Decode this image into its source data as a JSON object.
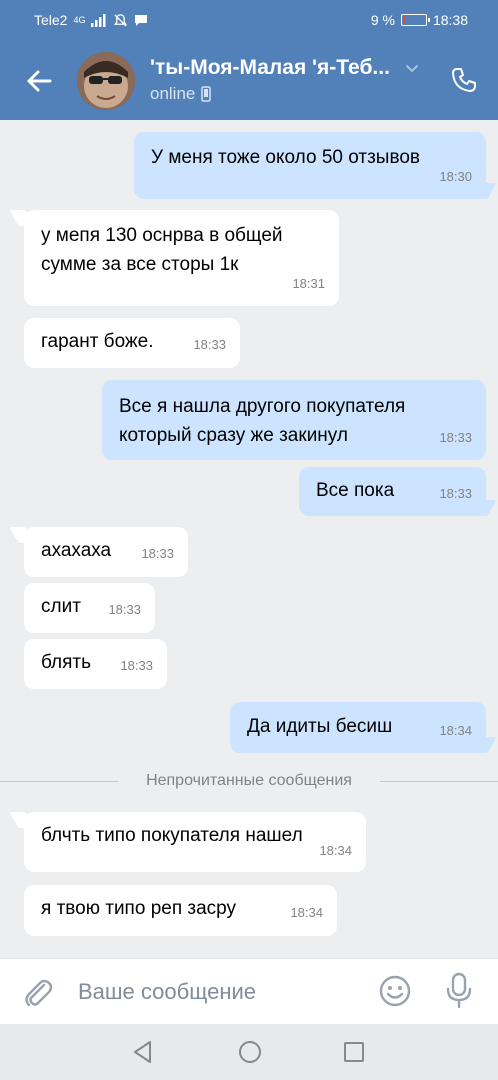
{
  "status_bar": {
    "carrier": "Tele2",
    "network": "4G",
    "battery_text": "9 %",
    "battery_level": 0.09,
    "battery_color": "#e64646",
    "time": "18:38"
  },
  "header": {
    "title": "'ты-Моя-Малая 'я-Теб...",
    "status": "online",
    "back_icon": "arrow-left-icon",
    "call_icon": "phone-icon",
    "bg_color": "#5181b8"
  },
  "messages": [
    {
      "direction": "out",
      "text": "У меня тоже около 50 отзывов",
      "time": "18:30"
    },
    {
      "direction": "in",
      "text": "у мепя 130 оснрва в общей сумме за все сторы 1к",
      "time": "18:31"
    },
    {
      "direction": "in",
      "text": "гарант боже.",
      "time": "18:33"
    },
    {
      "direction": "out",
      "text": "Все я нашла другого покупателя который сразу же закинул",
      "time": "18:33"
    },
    {
      "direction": "out",
      "text": "Все пока",
      "time": "18:33"
    },
    {
      "direction": "in",
      "text": "ахахаха",
      "time": "18:33"
    },
    {
      "direction": "in",
      "text": "слит",
      "time": "18:33"
    },
    {
      "direction": "in",
      "text": "блять",
      "time": "18:33"
    },
    {
      "direction": "out",
      "text": "Да идиты бесиш",
      "time": "18:34"
    },
    {
      "direction": "in",
      "text": "блчть типо покупателя нашел",
      "time": "18:34"
    },
    {
      "direction": "in",
      "text": "я твою типо реп засру",
      "time": "18:34"
    }
  ],
  "unread_divider": "Непрочитанные сообщения",
  "composer": {
    "placeholder": "Ваше сообщение",
    "attach_icon": "paperclip-icon",
    "emoji_icon": "smile-icon",
    "mic_icon": "microphone-icon"
  },
  "colors": {
    "incoming_bubble": "#ffffff",
    "outgoing_bubble": "#cce4ff",
    "chat_background": "#edeef0"
  }
}
